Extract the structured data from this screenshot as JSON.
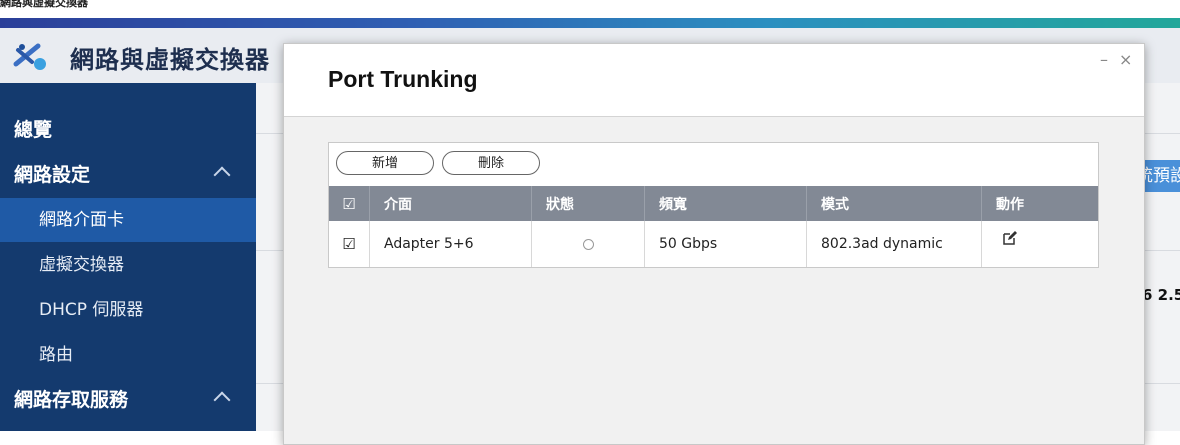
{
  "window": {
    "title": "網路與虛擬交換器"
  },
  "app": {
    "title": "網路與虛擬交換器",
    "icon": "network-switch-icon"
  },
  "sidebar": {
    "items": [
      {
        "label": "總覽",
        "type": "section"
      },
      {
        "label": "網路設定",
        "type": "section",
        "expanded": true
      },
      {
        "label": "網路介面卡",
        "type": "sub",
        "active": true
      },
      {
        "label": "虛擬交換器",
        "type": "sub"
      },
      {
        "label": "DHCP 伺服器",
        "type": "sub"
      },
      {
        "label": "路由",
        "type": "sub"
      },
      {
        "label": "網路存取服務",
        "type": "section",
        "expanded": true
      }
    ]
  },
  "background": {
    "button_label": "統預設",
    "text": "6 2.5"
  },
  "modal": {
    "title": "Port Trunking",
    "minimize": "–",
    "close": "×",
    "toolbar": {
      "add_label": "新增",
      "delete_label": "刪除"
    },
    "table": {
      "header_checkbox": "☑",
      "columns": [
        "介面",
        "狀態",
        "頻寬",
        "模式",
        "動作"
      ],
      "rows": [
        {
          "checkbox": "☑",
          "interface": "Adapter 5+6",
          "status": "status-dot-icon",
          "bandwidth": "50 Gbps",
          "mode": "802.3ad dynamic",
          "action": "edit-icon"
        }
      ]
    }
  }
}
